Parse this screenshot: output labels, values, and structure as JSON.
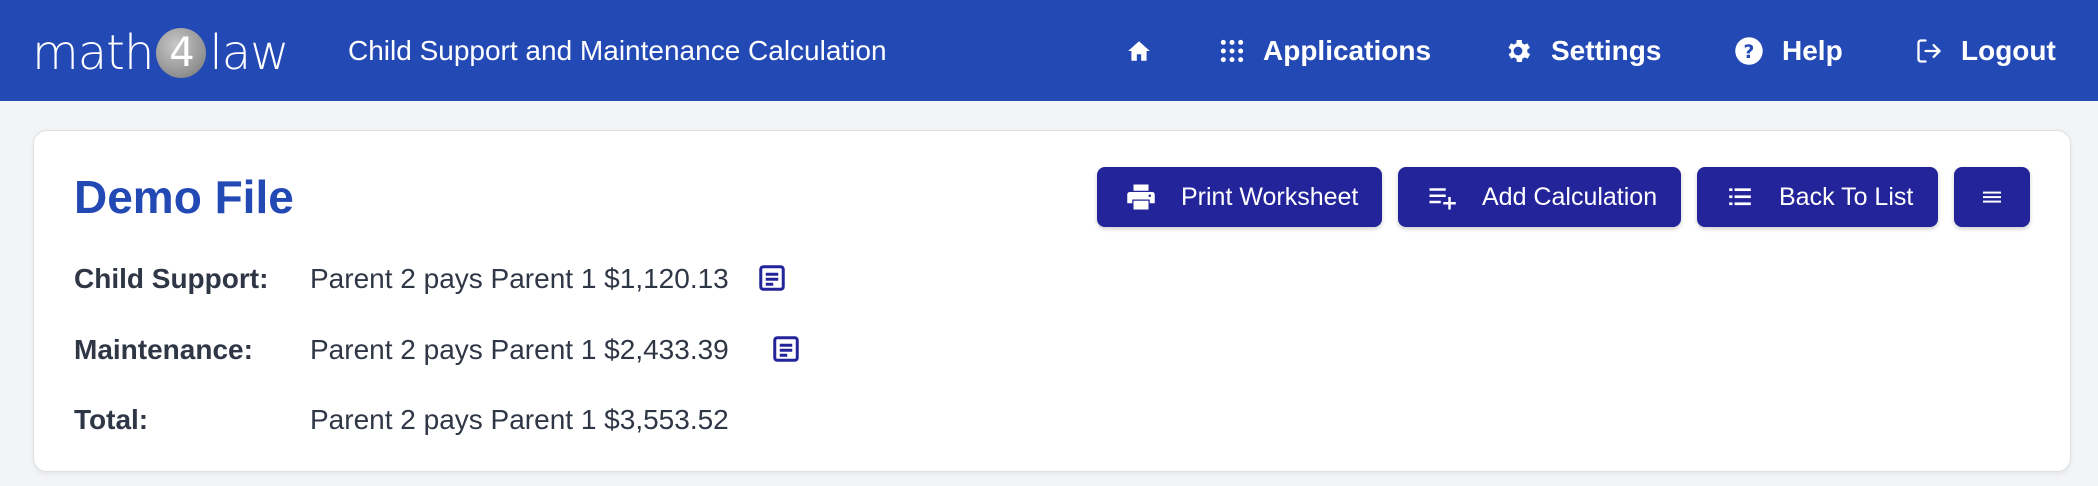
{
  "header": {
    "logo": {
      "left": "math",
      "digit": "4",
      "right": "law"
    },
    "app_title": "Child Support and Maintenance Calculation",
    "nav": {
      "home_icon": "home-icon",
      "applications": "Applications",
      "settings": "Settings",
      "help": "Help",
      "logout": "Logout"
    }
  },
  "file": {
    "title": "Demo File",
    "actions": {
      "print": "Print Worksheet",
      "add": "Add Calculation",
      "back": "Back To List",
      "menu_icon": "hamburger-menu-icon"
    }
  },
  "results": [
    {
      "label": "Child Support:",
      "value": "Parent 2 pays Parent 1 $1,120.13",
      "icon": "worksheet-doc-icon"
    },
    {
      "label": "Maintenance:",
      "value": "Parent 2 pays Parent 1 $2,433.39",
      "icon": "worksheet-doc-icon"
    },
    {
      "label": "Total:",
      "value": "Parent 2 pays Parent 1 $3,553.52"
    }
  ],
  "colors": {
    "header_bg": "#2349b5",
    "button_bg": "#23239a",
    "title": "#2349b5",
    "text": "#2f3645"
  }
}
